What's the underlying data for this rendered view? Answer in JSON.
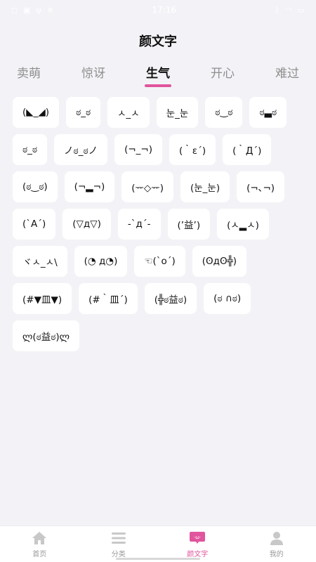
{
  "status_bar": {
    "time": "17:16"
  },
  "header": {
    "title": "颜文字"
  },
  "tabs": [
    {
      "label": "卖萌"
    },
    {
      "label": "惊讶"
    },
    {
      "label": "生气"
    },
    {
      "label": "开心"
    },
    {
      "label": "难过"
    }
  ],
  "active_tab_index": 2,
  "emoticons": [
    "(◣_◢)",
    "ಠ_ಠ",
    "ㅅ_ㅅ",
    "눈_눈",
    "ಠ‿ಠ",
    "ಠ▃ಠ",
    "ಠ_ಠ",
    "ノಠ_ಠノ",
    "(¬_¬)",
    "(｀ε´)",
    "(｀Д´)",
    "(ಠ‿ಠ)",
    "(¬▂¬)",
    "(ᅲ◇ᅲ)",
    "(눈_눈)",
    "(¬､¬)",
    "(`A´)",
    "(▽д▽)",
    "-`д´-",
    "(’益’)",
    "(ㅅ▂ㅅ)",
    "ヾㅅ_ㅅ\\",
    "(◔ д◔)",
    "☜(`o´)",
    "(ʘдʘ╬)",
    "(#▼皿▼)",
    "(#｀皿´)",
    "(╬ಠ益ಠ)",
    "(ಠ ∩ಠ)",
    "ლ(ಠ益ಠ)ლ"
  ],
  "bottom_nav": [
    {
      "label": "首页",
      "icon": "home-icon"
    },
    {
      "label": "分类",
      "icon": "menu-icon"
    },
    {
      "label": "颜文字",
      "icon": "kaomoji-icon"
    },
    {
      "label": "我的",
      "icon": "user-icon"
    }
  ],
  "colors": {
    "accent": "#e0559d",
    "background": "#f3f3f7",
    "chip": "#ffffff"
  }
}
